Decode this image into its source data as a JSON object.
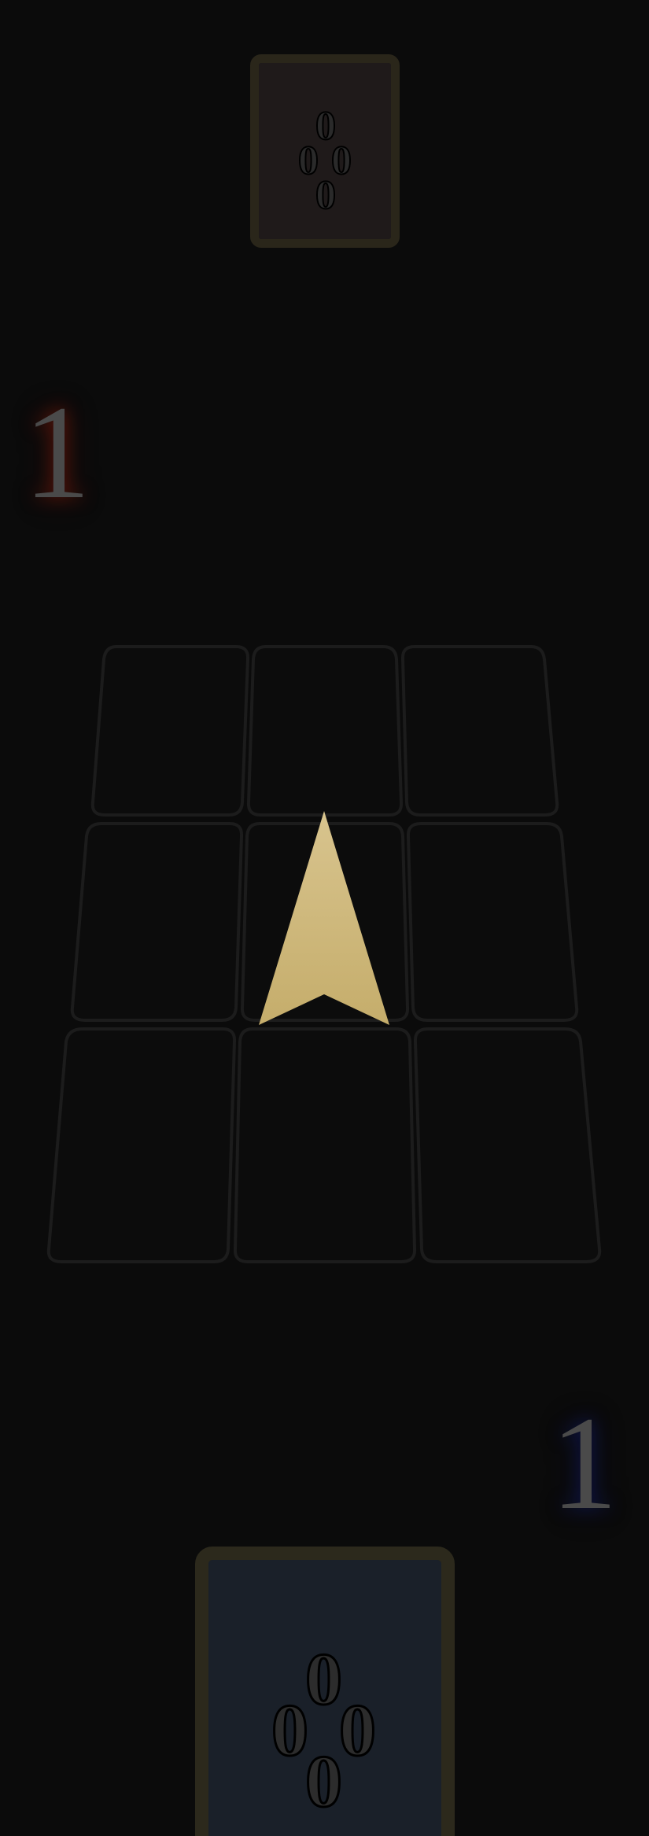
{
  "opponent": {
    "score": "1",
    "card": {
      "pip_symbol": "0",
      "pip_count": 4,
      "face_color": "#1f1a1a",
      "border_color": "#2a261a"
    }
  },
  "player": {
    "score": "1",
    "card": {
      "pip_symbol": "0",
      "pip_count": 4,
      "face_color": "#1a2029",
      "border_color": "#2c291c"
    }
  },
  "board": {
    "rows": 3,
    "cols": 3,
    "cells": [
      {
        "id": "r1c1",
        "content": ""
      },
      {
        "id": "r1c2",
        "content": ""
      },
      {
        "id": "r1c3",
        "content": ""
      },
      {
        "id": "r2c1",
        "content": ""
      },
      {
        "id": "r2c2",
        "content": ""
      },
      {
        "id": "r2c3",
        "content": ""
      },
      {
        "id": "r3c1",
        "content": ""
      },
      {
        "id": "r3c2",
        "content": ""
      },
      {
        "id": "r3c3",
        "content": ""
      }
    ],
    "turn_indicator": {
      "icon": "arrow-up-icon",
      "direction": "up",
      "color_top": "#d8c48e",
      "color_bottom": "#c5ad6b"
    }
  },
  "colors": {
    "background": "#0b0b0b",
    "opponent_glow": "#a01e0a",
    "player_glow": "#141e78",
    "score_text": "#4a4a4a"
  }
}
